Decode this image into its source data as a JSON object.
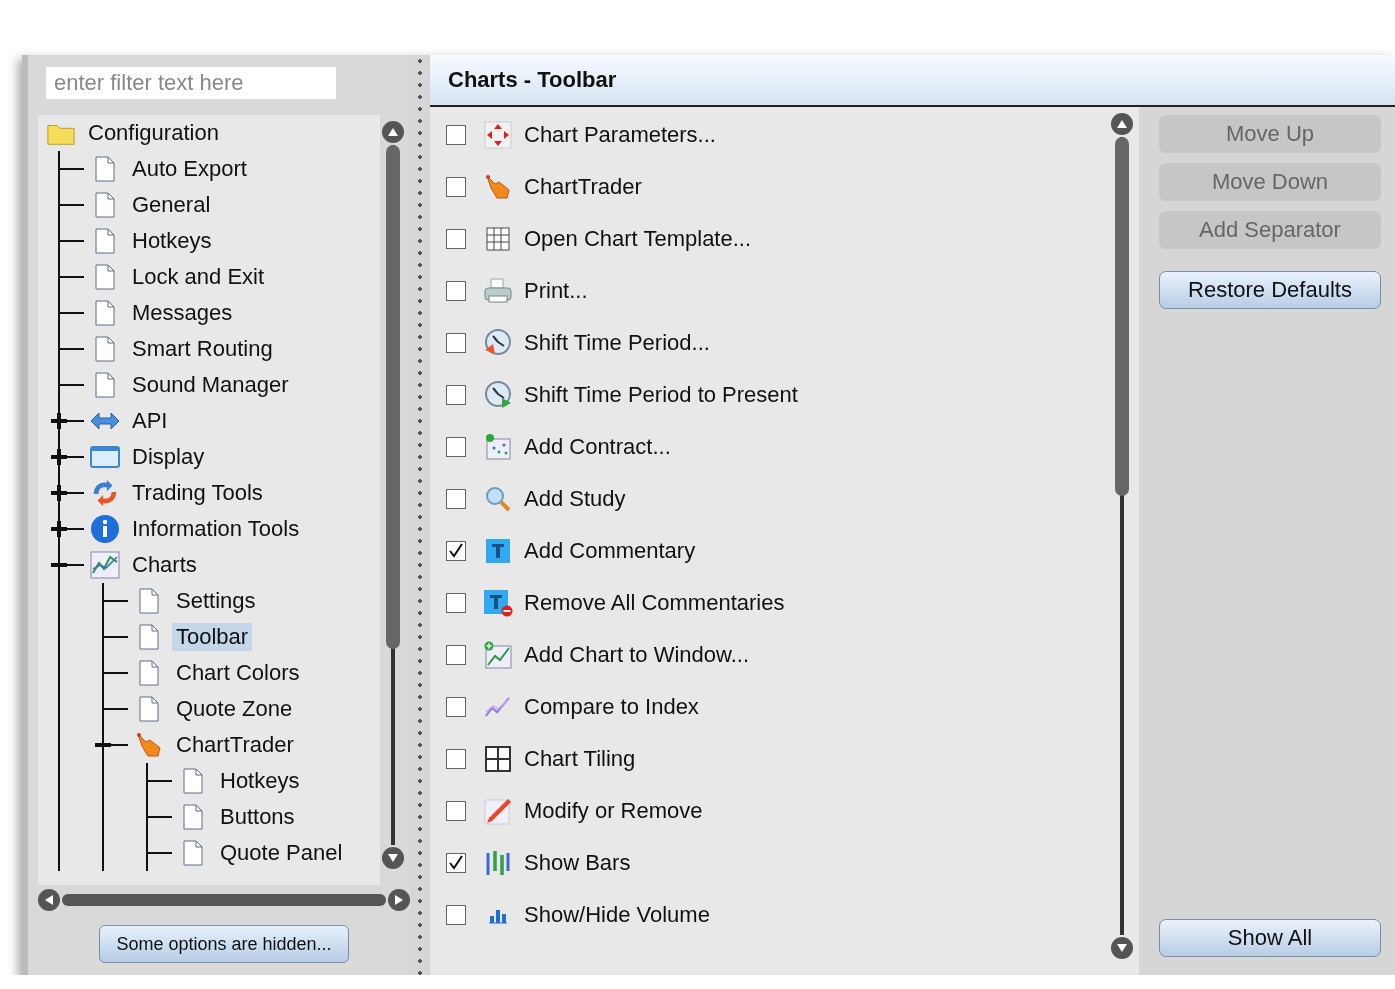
{
  "filter": {
    "placeholder": "enter filter text here"
  },
  "tree": [
    {
      "label": "Configuration",
      "kind": "folder",
      "selected": false,
      "children": [
        {
          "label": "Auto Export",
          "kind": "page",
          "selected": false
        },
        {
          "label": "General",
          "kind": "page",
          "selected": false
        },
        {
          "label": "Hotkeys",
          "kind": "page",
          "selected": false
        },
        {
          "label": "Lock and Exit",
          "kind": "page",
          "selected": false
        },
        {
          "label": "Messages",
          "kind": "page",
          "selected": false
        },
        {
          "label": "Smart Routing",
          "kind": "page",
          "selected": false
        },
        {
          "label": "Sound Manager",
          "kind": "page",
          "selected": false
        },
        {
          "label": "API",
          "kind": "api",
          "selected": false,
          "expanded": false
        },
        {
          "label": "Display",
          "kind": "display",
          "selected": false,
          "expanded": false
        },
        {
          "label": "Trading Tools",
          "kind": "trading",
          "selected": false,
          "expanded": false
        },
        {
          "label": "Information Tools",
          "kind": "info",
          "selected": false,
          "expanded": false
        },
        {
          "label": "Charts",
          "kind": "chart",
          "selected": false,
          "expanded": true,
          "children": [
            {
              "label": "Settings",
              "kind": "page",
              "selected": false
            },
            {
              "label": "Toolbar",
              "kind": "page",
              "selected": true
            },
            {
              "label": "Chart Colors",
              "kind": "page",
              "selected": false
            },
            {
              "label": "Quote Zone",
              "kind": "page",
              "selected": false
            },
            {
              "label": "ChartTrader",
              "kind": "charttrader",
              "selected": false,
              "expanded": true,
              "children": [
                {
                  "label": "Hotkeys",
                  "kind": "page",
                  "selected": false
                },
                {
                  "label": "Buttons",
                  "kind": "page",
                  "selected": false
                },
                {
                  "label": "Quote Panel",
                  "kind": "page",
                  "selected": false
                }
              ]
            }
          ]
        }
      ]
    }
  ],
  "hidden_options_button": "Some options are hidden...",
  "panel_title": "Charts - Toolbar",
  "toolbar_items": [
    {
      "label": "Chart Parameters...",
      "kind": "params",
      "checked": false
    },
    {
      "label": "ChartTrader",
      "kind": "charttrader",
      "checked": false
    },
    {
      "label": "Open Chart Template...",
      "kind": "grid",
      "checked": false
    },
    {
      "label": "Print...",
      "kind": "printer",
      "checked": false
    },
    {
      "label": "Shift Time Period...",
      "kind": "clock",
      "checked": false
    },
    {
      "label": "Shift Time Period to Present",
      "kind": "clockplay",
      "checked": false
    },
    {
      "label": "Add Contract...",
      "kind": "contract",
      "checked": false
    },
    {
      "label": "Add Study",
      "kind": "magnifier",
      "checked": false
    },
    {
      "label": "Add Commentary",
      "kind": "text",
      "checked": true
    },
    {
      "label": "Remove All Commentaries",
      "kind": "textremove",
      "checked": false
    },
    {
      "label": "Add Chart to Window...",
      "kind": "addchart",
      "checked": false
    },
    {
      "label": "Compare to Index",
      "kind": "compare",
      "checked": false
    },
    {
      "label": "Chart Tiling",
      "kind": "tiles",
      "checked": false
    },
    {
      "label": "Modify or Remove",
      "kind": "pencil",
      "checked": false
    },
    {
      "label": "Show Bars",
      "kind": "bars",
      "checked": true
    },
    {
      "label": "Show/Hide Volume",
      "kind": "volume",
      "checked": false
    }
  ],
  "side_buttons": [
    {
      "label": "Move Up",
      "disabled": true
    },
    {
      "label": "Move Down",
      "disabled": true
    },
    {
      "label": "Add Separator",
      "disabled": true
    },
    {
      "label": "Restore Defaults",
      "disabled": false
    }
  ],
  "show_all_button": "Show All"
}
